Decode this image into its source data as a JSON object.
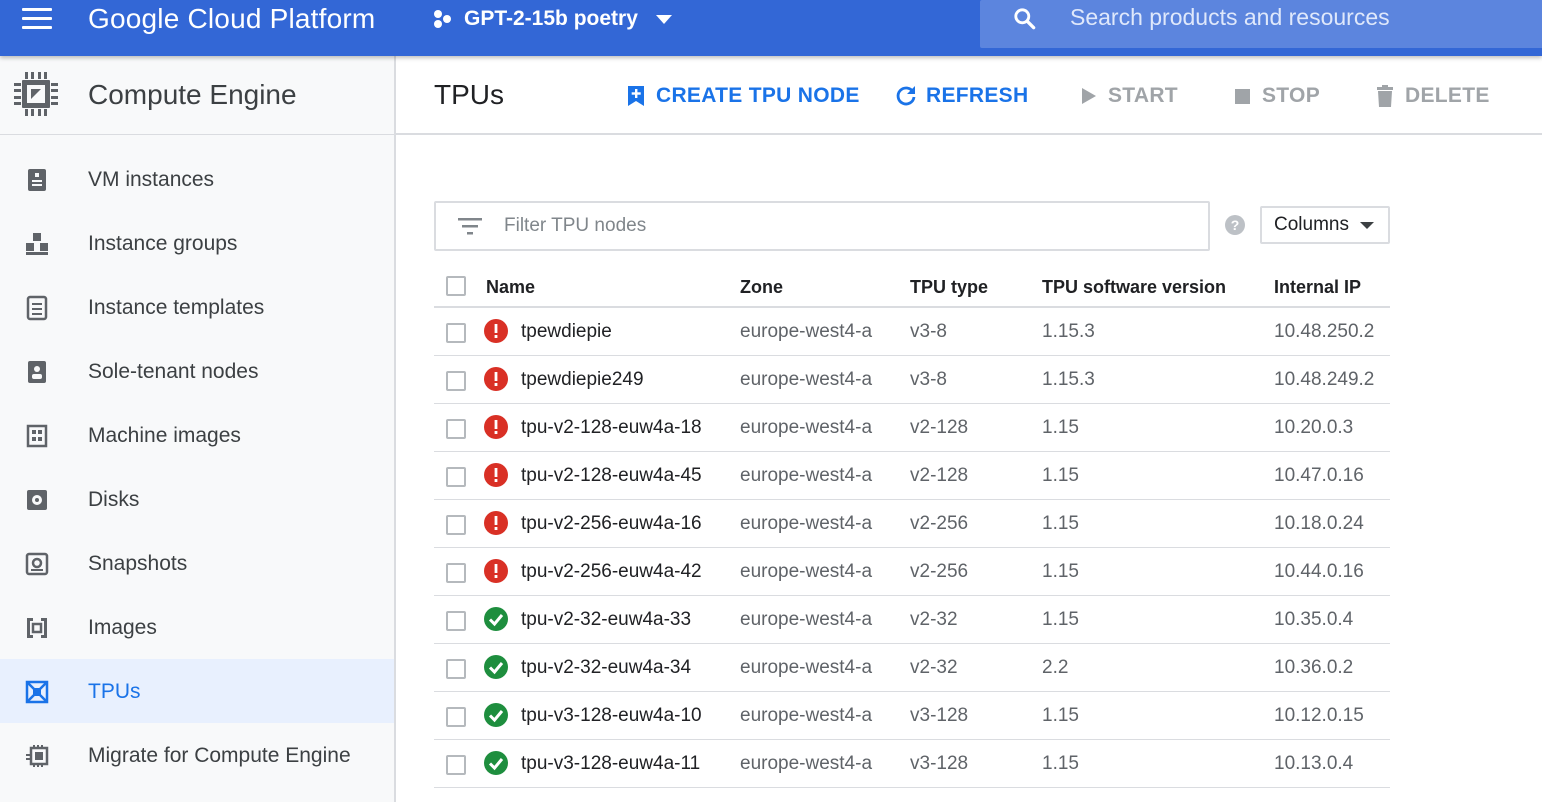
{
  "topbar": {
    "brand": "Google Cloud Platform",
    "project": "GPT-2-15b poetry",
    "search_placeholder": "Search products and resources",
    "color": "#3367d6"
  },
  "sidebar": {
    "title": "Compute Engine",
    "items": [
      {
        "label": "VM instances",
        "icon": "vm-instances-icon",
        "active": false
      },
      {
        "label": "Instance groups",
        "icon": "instance-groups-icon",
        "active": false
      },
      {
        "label": "Instance templates",
        "icon": "instance-templates-icon",
        "active": false
      },
      {
        "label": "Sole-tenant nodes",
        "icon": "sole-tenant-icon",
        "active": false
      },
      {
        "label": "Machine images",
        "icon": "machine-images-icon",
        "active": false
      },
      {
        "label": "Disks",
        "icon": "disk-icon",
        "active": false
      },
      {
        "label": "Snapshots",
        "icon": "snapshot-icon",
        "active": false
      },
      {
        "label": "Images",
        "icon": "images-icon",
        "active": false
      },
      {
        "label": "TPUs",
        "icon": "tpu-icon",
        "active": true
      },
      {
        "label": "Migrate for Compute Engine",
        "icon": "migrate-icon",
        "active": false
      }
    ]
  },
  "main": {
    "title": "TPUs",
    "toolbar": {
      "create": "CREATE TPU NODE",
      "refresh": "REFRESH",
      "start": "START",
      "stop": "STOP",
      "delete": "DELETE"
    },
    "filter_placeholder": "Filter TPU nodes",
    "columns_label": "Columns",
    "table": {
      "headers": [
        "Name",
        "Zone",
        "TPU type",
        "TPU software version",
        "Internal IP"
      ],
      "rows": [
        {
          "status": "error",
          "name": "tpewdiepie",
          "zone": "europe-west4-a",
          "type": "v3-8",
          "version": "1.15.3",
          "ip": "10.48.250.2"
        },
        {
          "status": "error",
          "name": "tpewdiepie249",
          "zone": "europe-west4-a",
          "type": "v3-8",
          "version": "1.15.3",
          "ip": "10.48.249.2"
        },
        {
          "status": "error",
          "name": "tpu-v2-128-euw4a-18",
          "zone": "europe-west4-a",
          "type": "v2-128",
          "version": "1.15",
          "ip": "10.20.0.3"
        },
        {
          "status": "error",
          "name": "tpu-v2-128-euw4a-45",
          "zone": "europe-west4-a",
          "type": "v2-128",
          "version": "1.15",
          "ip": "10.47.0.16"
        },
        {
          "status": "error",
          "name": "tpu-v2-256-euw4a-16",
          "zone": "europe-west4-a",
          "type": "v2-256",
          "version": "1.15",
          "ip": "10.18.0.24"
        },
        {
          "status": "error",
          "name": "tpu-v2-256-euw4a-42",
          "zone": "europe-west4-a",
          "type": "v2-256",
          "version": "1.15",
          "ip": "10.44.0.16"
        },
        {
          "status": "ok",
          "name": "tpu-v2-32-euw4a-33",
          "zone": "europe-west4-a",
          "type": "v2-32",
          "version": "1.15",
          "ip": "10.35.0.4"
        },
        {
          "status": "ok",
          "name": "tpu-v2-32-euw4a-34",
          "zone": "europe-west4-a",
          "type": "v2-32",
          "version": "2.2",
          "ip": "10.36.0.2"
        },
        {
          "status": "ok",
          "name": "tpu-v3-128-euw4a-10",
          "zone": "europe-west4-a",
          "type": "v3-128",
          "version": "1.15",
          "ip": "10.12.0.15"
        },
        {
          "status": "ok",
          "name": "tpu-v3-128-euw4a-11",
          "zone": "europe-west4-a",
          "type": "v3-128",
          "version": "1.15",
          "ip": "10.13.0.4"
        }
      ]
    }
  },
  "colors": {
    "accent": "#1a73e8",
    "error": "#d93025",
    "ok": "#1e8e3e",
    "disabled": "#a0a4a8"
  }
}
